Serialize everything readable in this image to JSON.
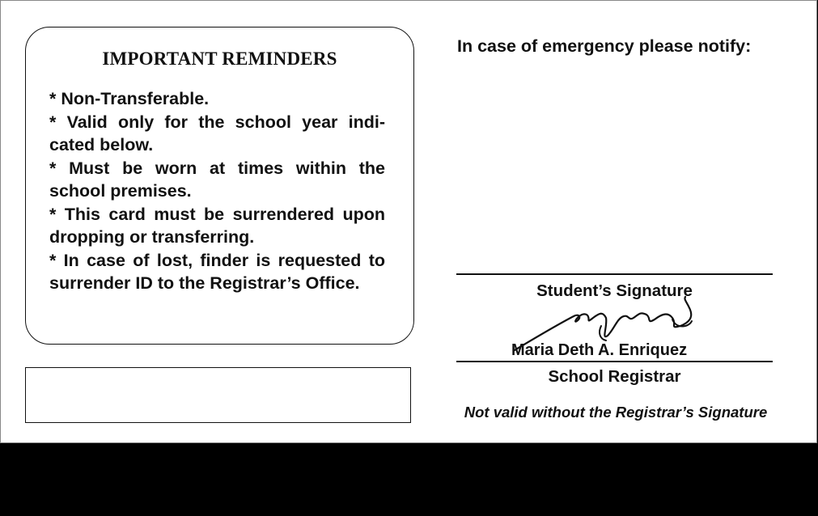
{
  "reminders": {
    "title": "IMPORTANT REMINDERS",
    "items": [
      "* Non-Transferable.",
      "* Valid only for the school year indi-cated below.",
      "* Must be worn at times within the school premises.",
      "* This card must be surrendered upon dropping or transferring.",
      "* In case of lost, finder is requested to surrender ID to the Registrar’s Office."
    ]
  },
  "emergency": {
    "label": "In case of emergency please notify:"
  },
  "signatures": {
    "student_caption": "Student’s Signature",
    "registrar_name": "Maria Deth A. Enriquez",
    "registrar_caption": "School Registrar",
    "validity_note": "Not valid without the Registrar’s Signature"
  }
}
